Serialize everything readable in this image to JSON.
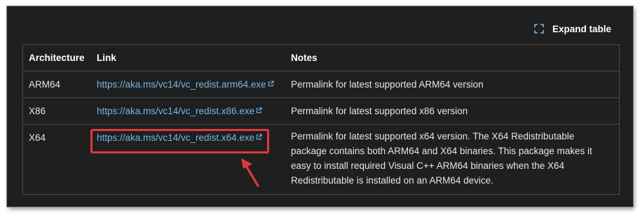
{
  "toolbar": {
    "expand_label": "Expand table",
    "expand_icon": "expand-icon"
  },
  "table": {
    "headers": [
      "Architecture",
      "Link",
      "Notes"
    ],
    "rows": [
      {
        "architecture": "ARM64",
        "link": "https://aka.ms/vc14/vc_redist.arm64.exe",
        "notes": "Permalink for latest supported ARM64 version"
      },
      {
        "architecture": "X86",
        "link": "https://aka.ms/vc14/vc_redist.x86.exe",
        "notes": "Permalink for latest supported x86 version"
      },
      {
        "architecture": "X64",
        "link": "https://aka.ms/vc14/vc_redist.x64.exe",
        "notes_lines": [
          "Permalink for latest supported x64 version. The X64 Redistributable",
          "package contains both ARM64 and X64 binaries. This package makes it",
          "easy to install required Visual C++ ARM64 binaries when the X64",
          "Redistributable is installed on an ARM64 device."
        ]
      }
    ]
  },
  "colors": {
    "background": "#1f1f1f",
    "link": "#75b6e7",
    "highlight": "#e03a3a"
  }
}
